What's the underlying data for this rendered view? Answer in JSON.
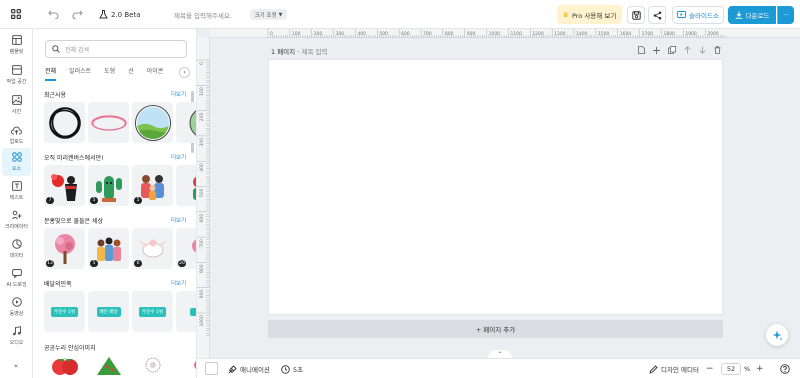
{
  "topbar": {
    "version": "2.0 Beta",
    "title_placeholder": "제목을 입력해주세요.",
    "size_adjust": "크기 조정",
    "pro_label": "Pro 사용해 보기",
    "slideshow_label": "슬라이드쇼",
    "download_label": "다운로드",
    "more_label": "···"
  },
  "rail": {
    "items": [
      {
        "label": "템플릿",
        "icon": "template-icon"
      },
      {
        "label": "작업 공간",
        "icon": "workspace-icon"
      },
      {
        "label": "사진",
        "icon": "photo-icon"
      },
      {
        "label": "업로드",
        "icon": "upload-icon"
      },
      {
        "label": "요소",
        "icon": "elements-icon"
      },
      {
        "label": "텍스트",
        "icon": "text-icon"
      },
      {
        "label": "크리에이터",
        "icon": "creator-icon"
      },
      {
        "label": "데이터",
        "icon": "data-icon"
      },
      {
        "label": "AI 드로잉",
        "icon": "ai-drawing-icon"
      },
      {
        "label": "동영상",
        "icon": "video-icon"
      },
      {
        "label": "오디오",
        "icon": "audio-icon"
      }
    ],
    "active_index": 4
  },
  "panel": {
    "search_placeholder": "전체 검색",
    "tabs": [
      "전체",
      "일러스트",
      "도형",
      "선",
      "아이콘"
    ],
    "sections": [
      {
        "title": "최근사용",
        "more": "더보기",
        "badges": []
      },
      {
        "title": "오직 미리캔버스에서만!",
        "more": "더보기",
        "badges": [
          "7",
          "5",
          "5"
        ]
      },
      {
        "title": "분홍빛으로 물들은 세상",
        "more": "더보기",
        "badges": [
          "13",
          "5",
          "6",
          "20"
        ]
      },
      {
        "title": "배달의민족",
        "more": "더보기",
        "badges": []
      },
      {
        "title": "공공누리 안심이미지",
        "more": "",
        "badges": []
      }
    ],
    "baemin_chips": [
      "주문수 1위",
      "배민 배달",
      "주문수 1위"
    ]
  },
  "canvas": {
    "page_label": "1 페이지",
    "page_title_placeholder": "제목 입력",
    "add_page": "+ 페이지 추가",
    "ruler_top": [
      "0",
      "100",
      "200",
      "300",
      "400",
      "500",
      "600",
      "700",
      "800",
      "900",
      "1000",
      "1100",
      "1200",
      "1300",
      "1400",
      "1500",
      "1600",
      "1700",
      "1800",
      "1900",
      "2000"
    ],
    "ruler_left": [
      "0",
      "100",
      "200",
      "300",
      "400",
      "500",
      "600",
      "700",
      "800",
      "900",
      "1000"
    ]
  },
  "bottombar": {
    "animation": "애니메이션",
    "duration": "5초",
    "design_editor": "디자인 에디터",
    "zoom": "52",
    "zoom_unit": "%"
  }
}
